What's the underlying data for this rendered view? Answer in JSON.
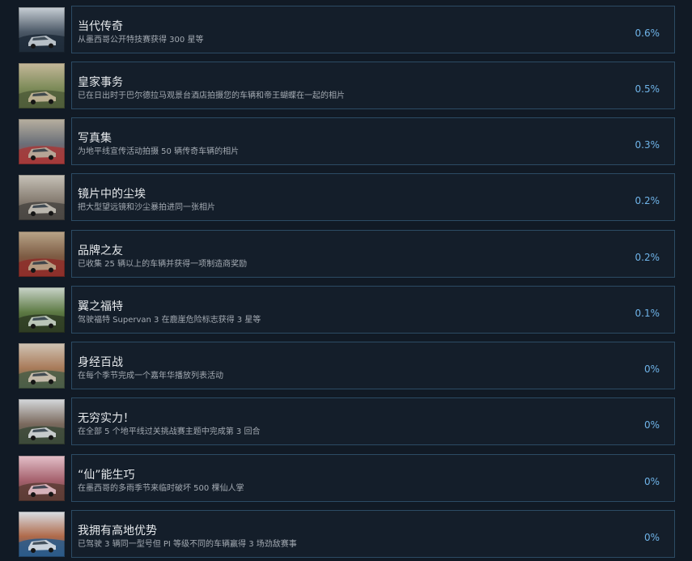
{
  "achievements": [
    {
      "title": "当代传奇",
      "description": "从墨西哥公开特技赛获得 300 星等",
      "percent": "0.6%",
      "icon": "modern-building-photo-icon",
      "colors": [
        "#4b5866",
        "#c9d0d6",
        "#1e2b39"
      ]
    },
    {
      "title": "皇家事务",
      "description": "已在日出时于巴尔德拉马观景台酒店拍摄您的车辆和帝王蝴蝶在一起的相片",
      "percent": "0.5%",
      "icon": "hotel-view-photo-icon",
      "colors": [
        "#7e8c5a",
        "#c5b89a",
        "#4f5d3a"
      ]
    },
    {
      "title": "写真集",
      "description": "为地平线宣传活动拍摄 50 辆传奇车辆的相片",
      "percent": "0.3%",
      "icon": "car-lineup-photo-icon",
      "colors": [
        "#6a6f78",
        "#b8b0a0",
        "#a53a3a"
      ]
    },
    {
      "title": "镜片中的尘埃",
      "description": "把大型望远镜和沙尘暴拍进同一张相片",
      "percent": "0.2%",
      "icon": "dust-storm-car-photo-icon",
      "colors": [
        "#8a8075",
        "#c7c2b8",
        "#4a4743"
      ]
    },
    {
      "title": "品牌之友",
      "description": "已收集 25 辆以上的车辆并获得一项制造商奖励",
      "percent": "0.2%",
      "icon": "car-collection-photo-icon",
      "colors": [
        "#7d5c44",
        "#b9a589",
        "#8d2f2a"
      ]
    },
    {
      "title": "翼之福特",
      "description": "驾驶福特 Supervan 3 在鹿崖危险标志获得 3 星等",
      "percent": "0.1%",
      "icon": "jumping-van-photo-icon",
      "colors": [
        "#5d7a44",
        "#c9d4c9",
        "#2f3d24"
      ]
    },
    {
      "title": "身经百战",
      "description": "在每个季节完成一个嘉年华播放列表活动",
      "percent": "0%",
      "icon": "festival-car-photo-icon",
      "colors": [
        "#a97b5a",
        "#d0c4b5",
        "#4a5d46"
      ]
    },
    {
      "title": "无穷实力！",
      "description": "在全部 5 个地平线过关挑战赛主题中完成第 3 回合",
      "percent": "0%",
      "icon": "offroad-jump-photo-icon",
      "colors": [
        "#7b6a5e",
        "#d5d9dc",
        "#3c4a3a"
      ]
    },
    {
      "title": "“仙”能生巧",
      "description": "在墨西哥的多雨季节来临时破坏 500 棵仙人掌",
      "percent": "0%",
      "icon": "cactus-car-photo-icon",
      "colors": [
        "#a5616d",
        "#e4c0c9",
        "#5c3c35"
      ]
    },
    {
      "title": "我拥有高地优势",
      "description": "已驾驶 3 辆同一型号但 PI 等级不同的车辆赢得 3 场劲敌赛事",
      "percent": "0%",
      "icon": "supercar-race-photo-icon",
      "colors": [
        "#b06a4a",
        "#d9dfe6",
        "#2a5a8a"
      ]
    }
  ]
}
